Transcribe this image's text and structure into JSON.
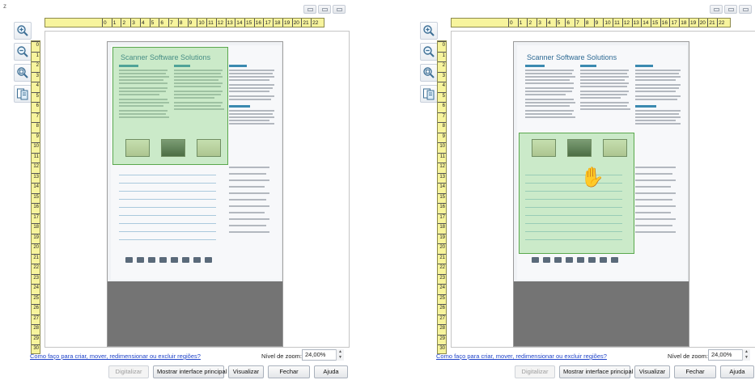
{
  "window": {
    "title": "z"
  },
  "ruler": {
    "top_ticks": [
      "0",
      "1",
      "2",
      "3",
      "4",
      "5",
      "6",
      "7",
      "8",
      "9",
      "10",
      "11",
      "12",
      "13",
      "14",
      "15",
      "16",
      "17",
      "18",
      "19",
      "20",
      "21",
      "22"
    ],
    "left_ticks": [
      "0",
      "1",
      "2",
      "3",
      "4",
      "5",
      "6",
      "7",
      "8",
      "9",
      "10",
      "11",
      "12",
      "13",
      "14",
      "15",
      "16",
      "17",
      "18",
      "19",
      "20",
      "21",
      "22",
      "23",
      "24",
      "25",
      "26",
      "27",
      "28",
      "29",
      "30"
    ]
  },
  "document": {
    "title": "Scanner Software Solutions"
  },
  "footer": {
    "help_link": "Como faço para criar, mover, redimensionar ou excluir regiões?",
    "zoom_label": "Nível de zoom:",
    "zoom_value": "24,00%"
  },
  "buttons": {
    "scan": "Digitalizar",
    "show_main": "Mostrar interface principal",
    "view": "Visualizar",
    "close": "Fechar",
    "help": "Ajuda"
  },
  "icons": [
    "zoom-in-icon",
    "zoom-out-icon",
    "fit-page-icon",
    "pages-icon"
  ],
  "colors": {
    "ruler": "#f7f49d",
    "region": "#78d26e",
    "link": "#1f43c9",
    "doc_title": "#2e6a94"
  }
}
